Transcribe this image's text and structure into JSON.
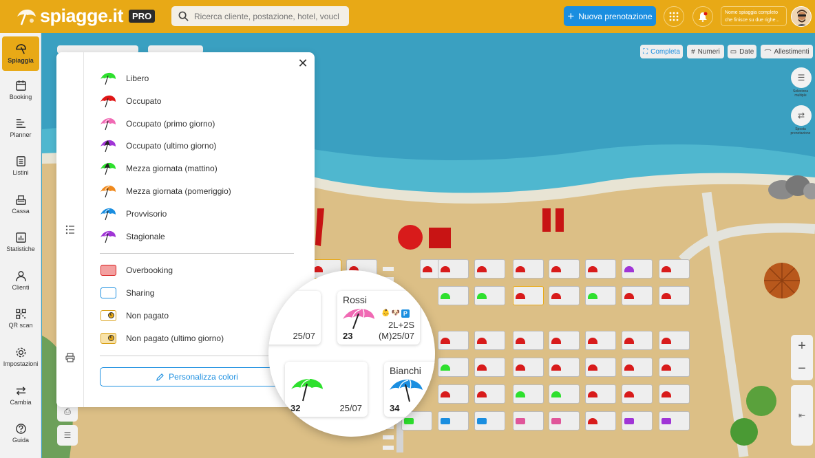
{
  "app": {
    "logo_text": "spiagge.it",
    "pro_badge": "PRO"
  },
  "header": {
    "search_placeholder": "Ricerca cliente, postazione, hotel, voucher...",
    "new_booking_label": "Nuova prenotazione",
    "beach_name_line1": "Nome spiaggia completo",
    "beach_name_line2": "che finisce su due righe..."
  },
  "sidebar": {
    "items": [
      {
        "label": "Spiaggia",
        "icon": "umbrella-icon"
      },
      {
        "label": "Booking",
        "icon": "calendar-icon"
      },
      {
        "label": "Planner",
        "icon": "planner-icon"
      },
      {
        "label": "Listini",
        "icon": "list-icon"
      },
      {
        "label": "Cassa",
        "icon": "cash-register-icon"
      },
      {
        "label": "Statistiche",
        "icon": "chart-icon"
      },
      {
        "label": "Clienti",
        "icon": "user-icon"
      },
      {
        "label": "QR scan",
        "icon": "qr-icon"
      },
      {
        "label": "Impostazioni",
        "icon": "gear-icon"
      },
      {
        "label": "Cambia",
        "icon": "swap-icon"
      },
      {
        "label": "Guida",
        "icon": "help-icon"
      }
    ]
  },
  "toolbar": {
    "complete": "Completa",
    "numbers": "Numeri",
    "date": "Date",
    "equipment": "Allestimenti"
  },
  "side_tools": {
    "multi_select": "Seleziona multiple",
    "move_booking": "Sposta prenotazione"
  },
  "legend": {
    "items": [
      {
        "label": "Libero",
        "color": "#2ee02e"
      },
      {
        "label": "Occupato",
        "color": "#e01616"
      },
      {
        "label": "Occupato (primo giorno)",
        "color": "#f06ab4"
      },
      {
        "label": "Occupato (ultimo giorno)",
        "color": "#a035d6"
      },
      {
        "label": "Mezza giornata (mattino)",
        "color": "#2ee02e"
      },
      {
        "label": "Mezza giornata (pomeriggio)",
        "color": "#f08a1e"
      },
      {
        "label": "Provvisorio",
        "color": "#1a8ee0"
      },
      {
        "label": "Stagionale",
        "color": "#a035d6"
      }
    ],
    "boxes": [
      {
        "label": "Overbooking"
      },
      {
        "label": "Sharing"
      },
      {
        "label": "Non pagato"
      },
      {
        "label": "Non pagato (ultimo giorno)"
      }
    ],
    "customize_label": "Personalizza colori"
  },
  "magnifier": {
    "card_left_date": "25/07",
    "card_rossi": {
      "name": "Rossi",
      "number": "23",
      "equipment": "2L+2S",
      "date": "(M)25/07",
      "color": "#f06ab4"
    },
    "card_32": {
      "number": "32",
      "date": "25/07",
      "color": "#2ee02e"
    },
    "card_bianchi": {
      "name": "Bianchi",
      "number": "34",
      "color": "#1a8ee0"
    }
  }
}
